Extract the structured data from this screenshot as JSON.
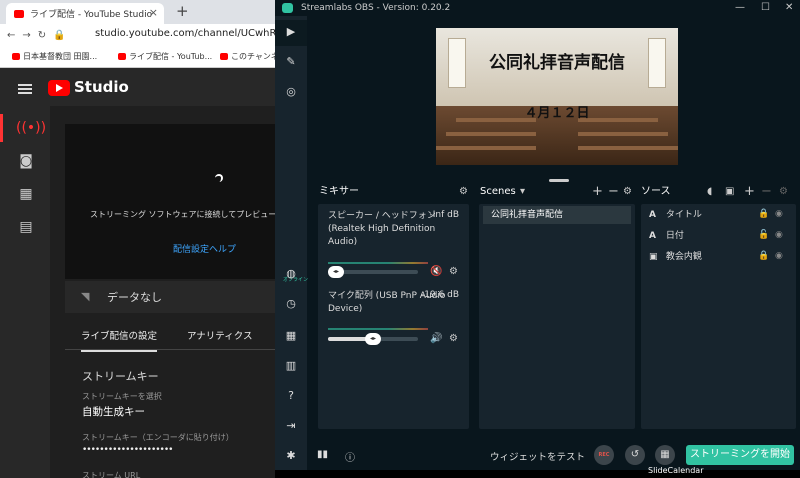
{
  "chrome": {
    "tab_title": "ライブ配信 - YouTube Studio",
    "tab_close": "×",
    "new_tab": "+",
    "url": "studio.youtube.com/channel/UCwhRQCV8C",
    "bookmarks": [
      "日本基督教団 田園...",
      "ライブ配信 - YouTub...",
      "このチャンネル"
    ]
  },
  "youtube": {
    "app_title": "Studio",
    "connect_message": "ストリーミング ソフトウェアに接続してプレビュー...",
    "help_link": "配信設定ヘルプ",
    "no_data": "データなし",
    "tabs": [
      "ライブ配信の設定",
      "アナリティクス"
    ],
    "stream_key_title": "ストリームキー",
    "stream_key_select_label": "ストリームキーを選択",
    "stream_key_select_value": "自動生成キー",
    "stream_key_paste_label": "ストリームキー（エンコーダに貼り付け）",
    "stream_key_masked": "•••••••••••••••••••••",
    "stream_url_label": "ストリーム URL"
  },
  "obs": {
    "title": "Streamlabs OBS - Version: 0.20.2",
    "window_buttons": [
      "—",
      "☐",
      "✕"
    ],
    "offline_badge": "オフライン",
    "stage_text_title": "公同礼拝音声配信",
    "stage_text_date": "４月１２日",
    "mixer": {
      "title": "ミキサー",
      "items": [
        {
          "name": "スピーカー / ヘッドフォン (Realtek High Definition Audio)",
          "db": "-Inf dB",
          "level": 0.0,
          "muted": true
        },
        {
          "name": "マイク配列 (USB PnP Audio Device)",
          "db": "-19.6 dB",
          "level": 0.5,
          "muted": false
        }
      ]
    },
    "scenes": {
      "title": "Scenes",
      "items": [
        "公同礼拝音声配信"
      ]
    },
    "sources": {
      "title": "ソース",
      "items": [
        {
          "type": "A",
          "name": "タイトル"
        },
        {
          "type": "A",
          "name": "日付"
        },
        {
          "type": "▣",
          "name": "教会内観"
        }
      ]
    },
    "footer": {
      "widget_test": "ウィジェットをテスト",
      "rec": "REC",
      "go_live": "ストリーミングを開始"
    }
  },
  "taskbar": {
    "slide_calendar": "SlideCalendar"
  }
}
